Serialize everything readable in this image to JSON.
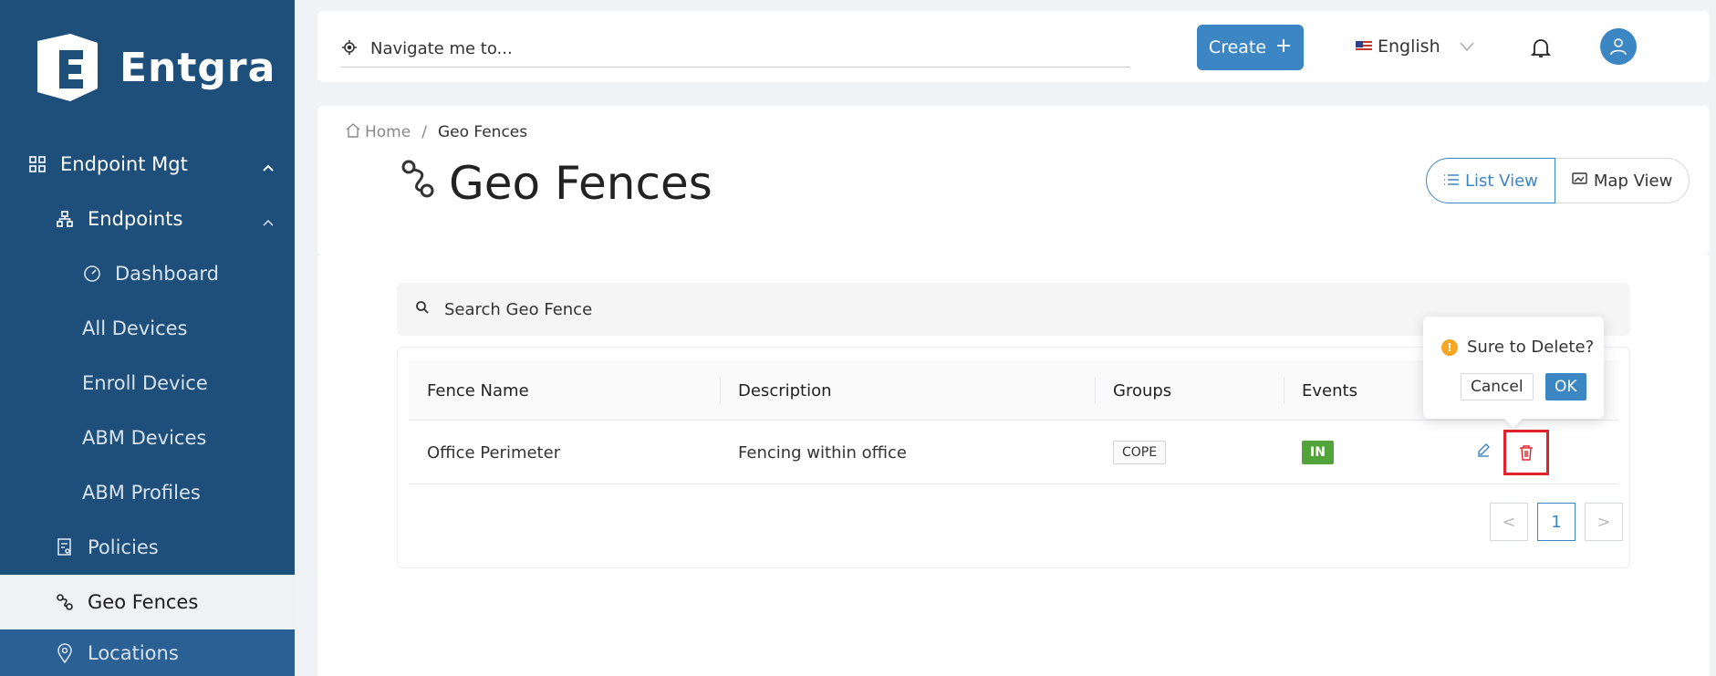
{
  "brand": {
    "name": "Entgra"
  },
  "sidebar": {
    "items": [
      {
        "label": "Endpoint Mgt",
        "icon": "grid-icon"
      },
      {
        "label": "Endpoints",
        "icon": "sitemap-icon"
      },
      {
        "label": "Dashboard",
        "icon": "speedometer-icon"
      },
      {
        "label": "All Devices"
      },
      {
        "label": "Enroll Device"
      },
      {
        "label": "ABM Devices"
      },
      {
        "label": "ABM Profiles"
      },
      {
        "label": "Policies",
        "icon": "policy-icon"
      },
      {
        "label": "Geo Fences",
        "icon": "geofence-icon"
      },
      {
        "label": "Locations",
        "icon": "location-pin-icon"
      }
    ]
  },
  "topbar": {
    "search_placeholder": "Navigate me to...",
    "create_label": "Create",
    "language": "English"
  },
  "breadcrumb": {
    "home": "Home",
    "separator": "/",
    "current": "Geo Fences"
  },
  "page": {
    "title": "Geo Fences",
    "list_view_label": "List View",
    "map_view_label": "Map View"
  },
  "search": {
    "placeholder": "Search Geo Fence"
  },
  "table": {
    "headers": [
      "Fence Name",
      "Description",
      "Groups",
      "Events"
    ],
    "rows": [
      {
        "fence_name": "Office Perimeter",
        "description": "Fencing within office",
        "group": "COPE",
        "event": "IN"
      }
    ]
  },
  "pagination": {
    "current": "1",
    "prev": "<",
    "next": ">"
  },
  "popconfirm": {
    "message": "Sure to Delete?",
    "cancel": "Cancel",
    "ok": "OK"
  },
  "colors": {
    "sidebar": "#1d4f7a",
    "accent": "#3d86c4",
    "success": "#52a33a",
    "warning": "#f5a623",
    "danger": "#e0222b"
  }
}
